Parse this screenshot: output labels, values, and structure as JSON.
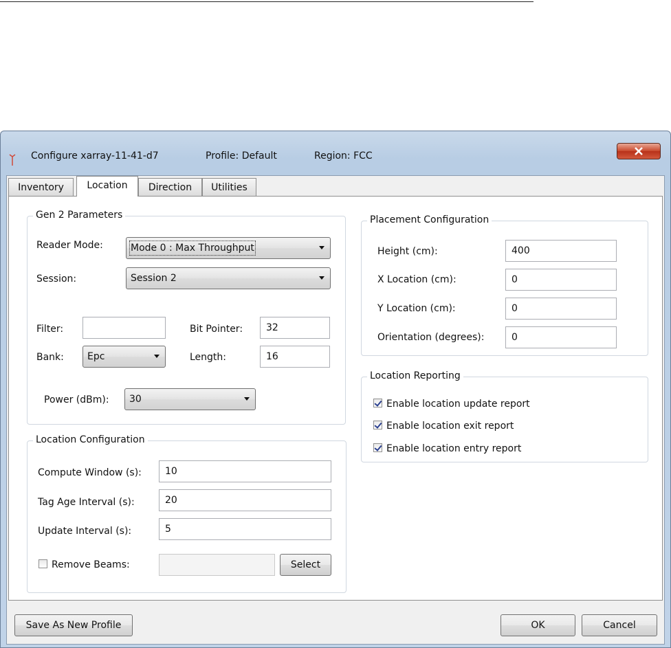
{
  "window": {
    "title": "Configure xarray-11-41-d7",
    "profile": "Profile: Default",
    "region": "Region: FCC"
  },
  "tabs": [
    {
      "label": "Inventory"
    },
    {
      "label": "Location"
    },
    {
      "label": "Direction"
    },
    {
      "label": "Utilities"
    }
  ],
  "gen2": {
    "legend": "Gen 2 Parameters",
    "reader_mode_label": "Reader Mode:",
    "reader_mode_value": "Mode 0 : Max Throughput",
    "session_label": "Session:",
    "session_value": "Session 2",
    "filter_label": "Filter:",
    "filter_value": "",
    "bit_pointer_label": "Bit Pointer:",
    "bit_pointer_value": "32",
    "bank_label": "Bank:",
    "bank_value": "Epc",
    "length_label": "Length:",
    "length_value": "16",
    "power_label": "Power (dBm):",
    "power_value": "30"
  },
  "location_config": {
    "legend": "Location Configuration",
    "compute_window_label": "Compute Window (s):",
    "compute_window_value": "10",
    "tag_age_label": "Tag Age Interval (s):",
    "tag_age_value": "20",
    "update_interval_label": "Update Interval (s):",
    "update_interval_value": "5",
    "remove_beams_label": "Remove Beams:",
    "remove_beams_checked": false,
    "remove_beams_value": "",
    "select_label": "Select"
  },
  "placement": {
    "legend": "Placement Configuration",
    "height_label": "Height (cm):",
    "height_value": "400",
    "x_label": "X Location (cm):",
    "x_value": "0",
    "y_label": "Y Location (cm):",
    "y_value": "0",
    "orientation_label": "Orientation (degrees):",
    "orientation_value": "0"
  },
  "reporting": {
    "legend": "Location Reporting",
    "items": [
      {
        "label": "Enable location update report",
        "checked": true
      },
      {
        "label": "Enable location exit report",
        "checked": true
      },
      {
        "label": "Enable location entry report",
        "checked": true
      }
    ]
  },
  "footer": {
    "save_profile_label": "Save As New Profile",
    "ok_label": "OK",
    "cancel_label": "Cancel"
  },
  "colors": {
    "close_button": "#c9482c",
    "check_mark": "#2a3f8f"
  }
}
